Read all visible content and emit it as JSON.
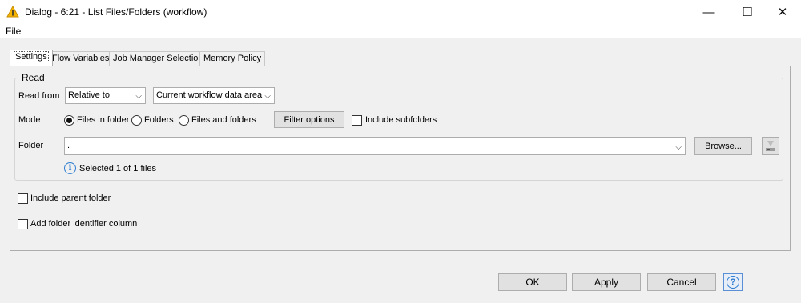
{
  "window": {
    "title": "Dialog - 6:21 - List Files/Folders (workflow)",
    "minimize_glyph": "—",
    "maximize_glyph": "☐",
    "close_glyph": "✕",
    "accent_warning": "#f5b400"
  },
  "menu": {
    "file_label": "File"
  },
  "tabs": [
    {
      "label": "Settings",
      "active": true
    },
    {
      "label": "Flow Variables",
      "active": false
    },
    {
      "label": "Job Manager Selection",
      "active": false
    },
    {
      "label": "Memory Policy",
      "active": false
    }
  ],
  "read_group": {
    "title": "Read",
    "read_from_label": "Read from",
    "read_from_value": "Relative to",
    "relative_to_value": "Current workflow data area",
    "mode_label": "Mode",
    "mode_options": [
      {
        "label": "Files in folder",
        "selected": true
      },
      {
        "label": "Folders",
        "selected": false
      },
      {
        "label": "Files and folders",
        "selected": false
      }
    ],
    "filter_options_label": "Filter options",
    "include_subfolders_label": "Include subfolders",
    "include_subfolders_checked": false,
    "folder_label": "Folder",
    "folder_value": ".",
    "browse_label": "Browse...",
    "status_text": "Selected 1 of 1 files",
    "info_icon_glyph": "i"
  },
  "options": {
    "include_parent_folder_label": "Include parent folder",
    "include_parent_folder_checked": false,
    "add_folder_identifier_label": "Add folder identifier column",
    "add_folder_identifier_checked": false
  },
  "buttons": {
    "ok": "OK",
    "apply": "Apply",
    "cancel": "Cancel",
    "help_glyph": "?"
  },
  "icons": {
    "title_icon": "warning-triangle-icon",
    "dropdown_arrow": "⌵",
    "fs_connection": "flow-variable-icon"
  }
}
